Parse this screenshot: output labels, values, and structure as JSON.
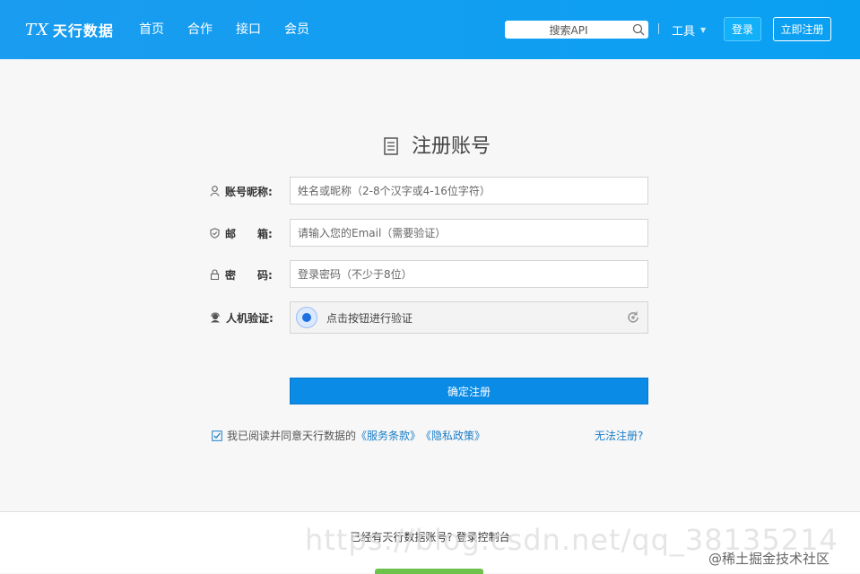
{
  "header": {
    "logo_mark": "TX",
    "logo_text": "天行数据",
    "nav": [
      "首页",
      "合作",
      "接口",
      "会员"
    ],
    "search_placeholder": "搜索API",
    "tools_label": "工具",
    "login_label": "登录",
    "register_label": "立即注册"
  },
  "form": {
    "title": "注册账号",
    "nickname": {
      "label": "账号昵称:",
      "placeholder": "姓名或昵称（2-8个汉字或4-16位字符）"
    },
    "email": {
      "label": "邮　　箱:",
      "placeholder": "请输入您的Email（需要验证）"
    },
    "password": {
      "label": "密　　码:",
      "placeholder": "登录密码（不少于8位）"
    },
    "captcha": {
      "label": "人机验证:",
      "text": "点击按钮进行验证"
    },
    "submit_label": "确定注册",
    "agree_prefix": "我已阅读并同意天行数据的",
    "terms_link": "《服务条款》",
    "privacy_link": "《隐私政策》",
    "cant_register": "无法注册?"
  },
  "footer": {
    "text": "已经有天行数据账号? 登录控制台"
  },
  "watermark": {
    "url": "https://blog.csdn.net/qq_38135214",
    "community": "@稀土掘金技术社区"
  }
}
